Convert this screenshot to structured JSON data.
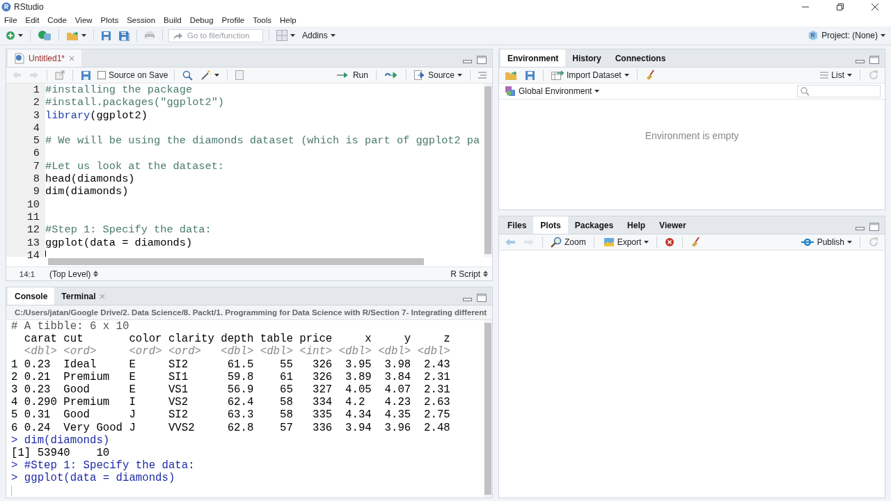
{
  "window": {
    "title": "RStudio"
  },
  "menu": [
    "File",
    "Edit",
    "Code",
    "View",
    "Plots",
    "Session",
    "Build",
    "Debug",
    "Profile",
    "Tools",
    "Help"
  ],
  "toolbar": {
    "goto_placeholder": "Go to file/function",
    "addins": "Addins",
    "project": "Project: (None)"
  },
  "editor": {
    "tabs": [
      {
        "label": "Untitled1*",
        "selected": true
      }
    ],
    "source_on_save": {
      "label": "Source on Save",
      "checked": false
    },
    "run": "Run",
    "source": "Source",
    "lines": [
      {
        "number": "1",
        "kind": "comment",
        "text": "#installing the package"
      },
      {
        "number": "2",
        "kind": "comment",
        "text": "#install.packages(\"ggplot2\")"
      },
      {
        "number": "3",
        "kind": "call",
        "keyword": "library",
        "text": "(ggplot2)"
      },
      {
        "number": "4",
        "kind": "blank"
      },
      {
        "number": "5",
        "kind": "comment",
        "text": "# We will be using the diamonds dataset (which is part of ggplot2 pa"
      },
      {
        "number": "6",
        "kind": "blank"
      },
      {
        "number": "7",
        "kind": "comment",
        "text": "#Let us look at the dataset:"
      },
      {
        "number": "8",
        "kind": "code",
        "text": "head(diamonds)"
      },
      {
        "number": "9",
        "kind": "code",
        "text": "dim(diamonds)"
      },
      {
        "number": "10",
        "kind": "blank"
      },
      {
        "number": "11",
        "kind": "blank"
      },
      {
        "number": "12",
        "kind": "comment",
        "text": "#Step 1: Specify the data:"
      },
      {
        "number": "13",
        "kind": "code",
        "text": "ggplot(data = diamonds)"
      },
      {
        "number": "14",
        "kind": "cursor"
      }
    ],
    "status": {
      "position": "14:1",
      "scope": "(Top Level)",
      "file_type": "R Script"
    }
  },
  "console": {
    "tabs": [
      {
        "label": "Console",
        "selected": true,
        "closable": false
      },
      {
        "label": "Terminal",
        "selected": false,
        "closable": true
      }
    ],
    "path": "C:/Users/jatan/Google Drive/2. Data Science/8. Packt/1. Programming for Data Science with R/Section 7- Integrating different",
    "lines": [
      {
        "kind": "comment",
        "text": "# A tibble: 6 x 10"
      },
      {
        "kind": "output",
        "text": "  carat cut       color clarity depth table price     x     y     z"
      },
      {
        "kind": "types",
        "text": "  <dbl> <ord>     <ord> <ord>   <dbl> <dbl> <int> <dbl> <dbl> <dbl>"
      },
      {
        "kind": "output",
        "text": "1 0.23  Ideal     E     SI2      61.5    55   326  3.95  3.98  2.43"
      },
      {
        "kind": "output",
        "text": "2 0.21  Premium   E     SI1      59.8    61   326  3.89  3.84  2.31"
      },
      {
        "kind": "output",
        "text": "3 0.23  Good      E     VS1      56.9    65   327  4.05  4.07  2.31"
      },
      {
        "kind": "output",
        "text": "4 0.290 Premium   I     VS2      62.4    58   334  4.2   4.23  2.63"
      },
      {
        "kind": "output",
        "text": "5 0.31  Good      J     SI2      63.3    58   335  4.34  4.35  2.75"
      },
      {
        "kind": "output",
        "text": "6 0.24  Very Good J     VVS2     62.8    57   336  3.94  3.96  2.48"
      },
      {
        "kind": "command",
        "prompt": ">",
        "text": "dim(diamonds)"
      },
      {
        "kind": "output",
        "text": "[1] 53940    10"
      },
      {
        "kind": "command",
        "prompt": ">",
        "text": "#Step 1: Specify the data:"
      },
      {
        "kind": "command",
        "prompt": ">",
        "text": "ggplot(data = diamonds)"
      },
      {
        "kind": "cursor"
      }
    ]
  },
  "environment": {
    "tabs": [
      {
        "label": "Environment",
        "selected": true
      },
      {
        "label": "History",
        "selected": false
      },
      {
        "label": "Connections",
        "selected": false
      }
    ],
    "import": "Import Dataset",
    "view": "List",
    "scope": "Global Environment",
    "empty_message": "Environment is empty"
  },
  "files": {
    "tabs": [
      {
        "label": "Files",
        "selected": false
      },
      {
        "label": "Plots",
        "selected": true
      },
      {
        "label": "Packages",
        "selected": false
      },
      {
        "label": "Help",
        "selected": false
      },
      {
        "label": "Viewer",
        "selected": false
      }
    ],
    "zoom": "Zoom",
    "export": "Export",
    "publish": "Publish"
  }
}
